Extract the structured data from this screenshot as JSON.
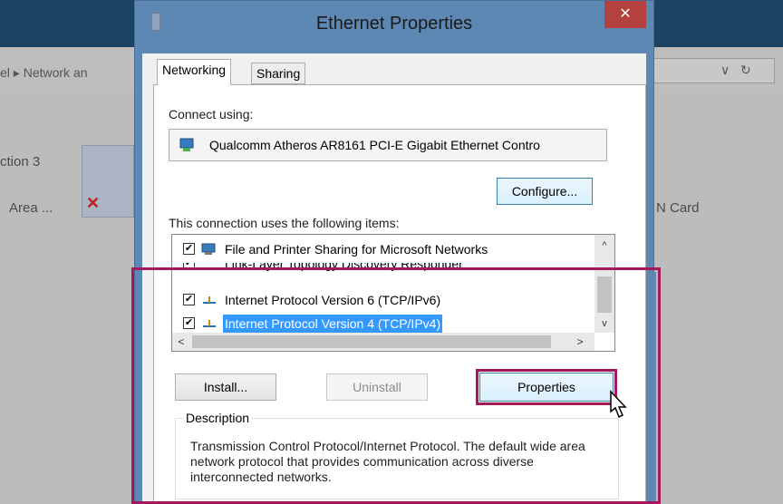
{
  "background": {
    "breadcrumb": "el  ▸  Network an",
    "addr_chevron": "∨",
    "addr_refresh": "↻",
    "item_left_1": "ction 3",
    "item_left_2": "Area ...",
    "item_right": "N Card"
  },
  "dialog": {
    "title": "Ethernet Properties",
    "close_label": "✕",
    "tabs": [
      {
        "label": "Networking",
        "active": true
      },
      {
        "label": "Sharing",
        "active": false
      }
    ],
    "connect_using_label": "Connect using:",
    "adapter_name": "Qualcomm Atheros AR8161 PCI-E Gigabit Ethernet Contro",
    "configure_button": "Configure...",
    "items_label": "This connection uses the following items:",
    "items": [
      {
        "label": "File and Printer Sharing for Microsoft Networks",
        "checked": true,
        "selected": false
      },
      {
        "label": "Link-Layer Topology Discovery Responder",
        "checked": true,
        "selected": false
      },
      {
        "label": "Internet Protocol Version 6 (TCP/IPv6)",
        "checked": true,
        "selected": false
      },
      {
        "label": "Internet Protocol Version 4 (TCP/IPv4)",
        "checked": true,
        "selected": true
      }
    ],
    "scroll": {
      "up": "^",
      "down": "v",
      "left": "<",
      "right": ">"
    },
    "install_button": "Install...",
    "uninstall_button": "Uninstall",
    "properties_button": "Properties",
    "description_label": "Description",
    "description_text": "Transmission Control Protocol/Internet Protocol. The default wide area network protocol that provides communication across diverse interconnected networks."
  },
  "colors": {
    "highlight": "#a3195b",
    "selection": "#3399ff",
    "title_bar": "#5d88b3",
    "close_button": "#b4413d"
  }
}
